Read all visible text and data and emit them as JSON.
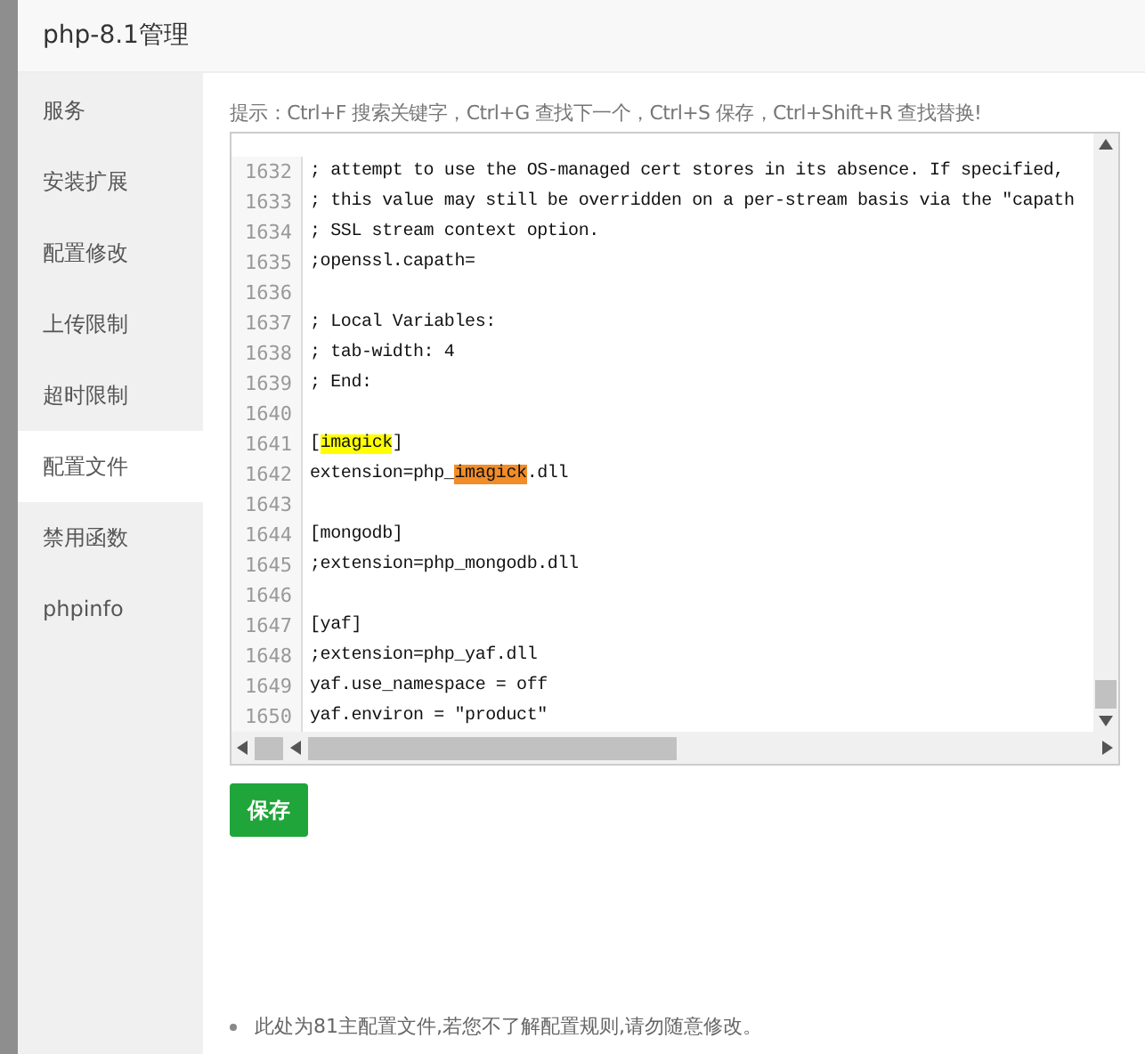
{
  "window": {
    "title": "php-8.1管理"
  },
  "sidebar": {
    "items": [
      {
        "label": "服务",
        "selected": false
      },
      {
        "label": "安装扩展",
        "selected": false
      },
      {
        "label": "配置修改",
        "selected": false
      },
      {
        "label": "上传限制",
        "selected": false
      },
      {
        "label": "超时限制",
        "selected": false
      },
      {
        "label": "配置文件",
        "selected": true
      },
      {
        "label": "禁用函数",
        "selected": false
      },
      {
        "label": "phpinfo",
        "selected": false
      }
    ]
  },
  "hint": "提示：Ctrl+F 搜索关键字，Ctrl+G 查找下一个，Ctrl+S 保存，Ctrl+Shift+R 查找替换!",
  "editor": {
    "lines": [
      {
        "number": "1632",
        "segments": [
          {
            "text": "; attempt to use the OS-managed cert stores in its absence. If specified,",
            "kind": "plain"
          }
        ]
      },
      {
        "number": "1633",
        "segments": [
          {
            "text": "; this value may still be overridden on a per-stream basis via the \"capath",
            "kind": "plain"
          }
        ]
      },
      {
        "number": "1634",
        "segments": [
          {
            "text": "; SSL stream context option.",
            "kind": "plain"
          }
        ]
      },
      {
        "number": "1635",
        "segments": [
          {
            "text": ";openssl.capath=",
            "kind": "plain"
          }
        ]
      },
      {
        "number": "1636"
      },
      {
        "number": "1637",
        "segments": [
          {
            "text": "; Local Variables:",
            "kind": "plain"
          }
        ]
      },
      {
        "number": "1638",
        "segments": [
          {
            "text": "; tab-width: 4",
            "kind": "plain"
          }
        ]
      },
      {
        "number": "1639",
        "segments": [
          {
            "text": "; End:",
            "kind": "plain"
          }
        ]
      },
      {
        "number": "1640"
      },
      {
        "number": "1641",
        "segments": [
          {
            "text": "[",
            "kind": "plain"
          },
          {
            "text": "imagick",
            "kind": "match"
          },
          {
            "text": "]",
            "kind": "plain"
          }
        ]
      },
      {
        "number": "1642",
        "segments": [
          {
            "text": "extension=php_",
            "kind": "plain"
          },
          {
            "text": "imagick",
            "kind": "current"
          },
          {
            "text": ".dll",
            "kind": "plain"
          }
        ]
      },
      {
        "number": "1643"
      },
      {
        "number": "1644",
        "segments": [
          {
            "text": "[mongodb]",
            "kind": "plain"
          }
        ]
      },
      {
        "number": "1645",
        "segments": [
          {
            "text": ";extension=php_mongodb.dll",
            "kind": "plain"
          }
        ]
      },
      {
        "number": "1646"
      },
      {
        "number": "1647",
        "segments": [
          {
            "text": "[yaf]",
            "kind": "plain"
          }
        ]
      },
      {
        "number": "1648",
        "segments": [
          {
            "text": ";extension=php_yaf.dll",
            "kind": "plain"
          }
        ]
      },
      {
        "number": "1649",
        "segments": [
          {
            "text": "yaf.use_namespace = off",
            "kind": "plain"
          }
        ]
      },
      {
        "number": "1650",
        "segments": [
          {
            "text": "yaf.environ = \"product\"",
            "kind": "plain"
          }
        ]
      }
    ]
  },
  "save_button": "保存",
  "notes": [
    "此处为81主配置文件,若您不了解配置规则,请勿随意修改。"
  ]
}
